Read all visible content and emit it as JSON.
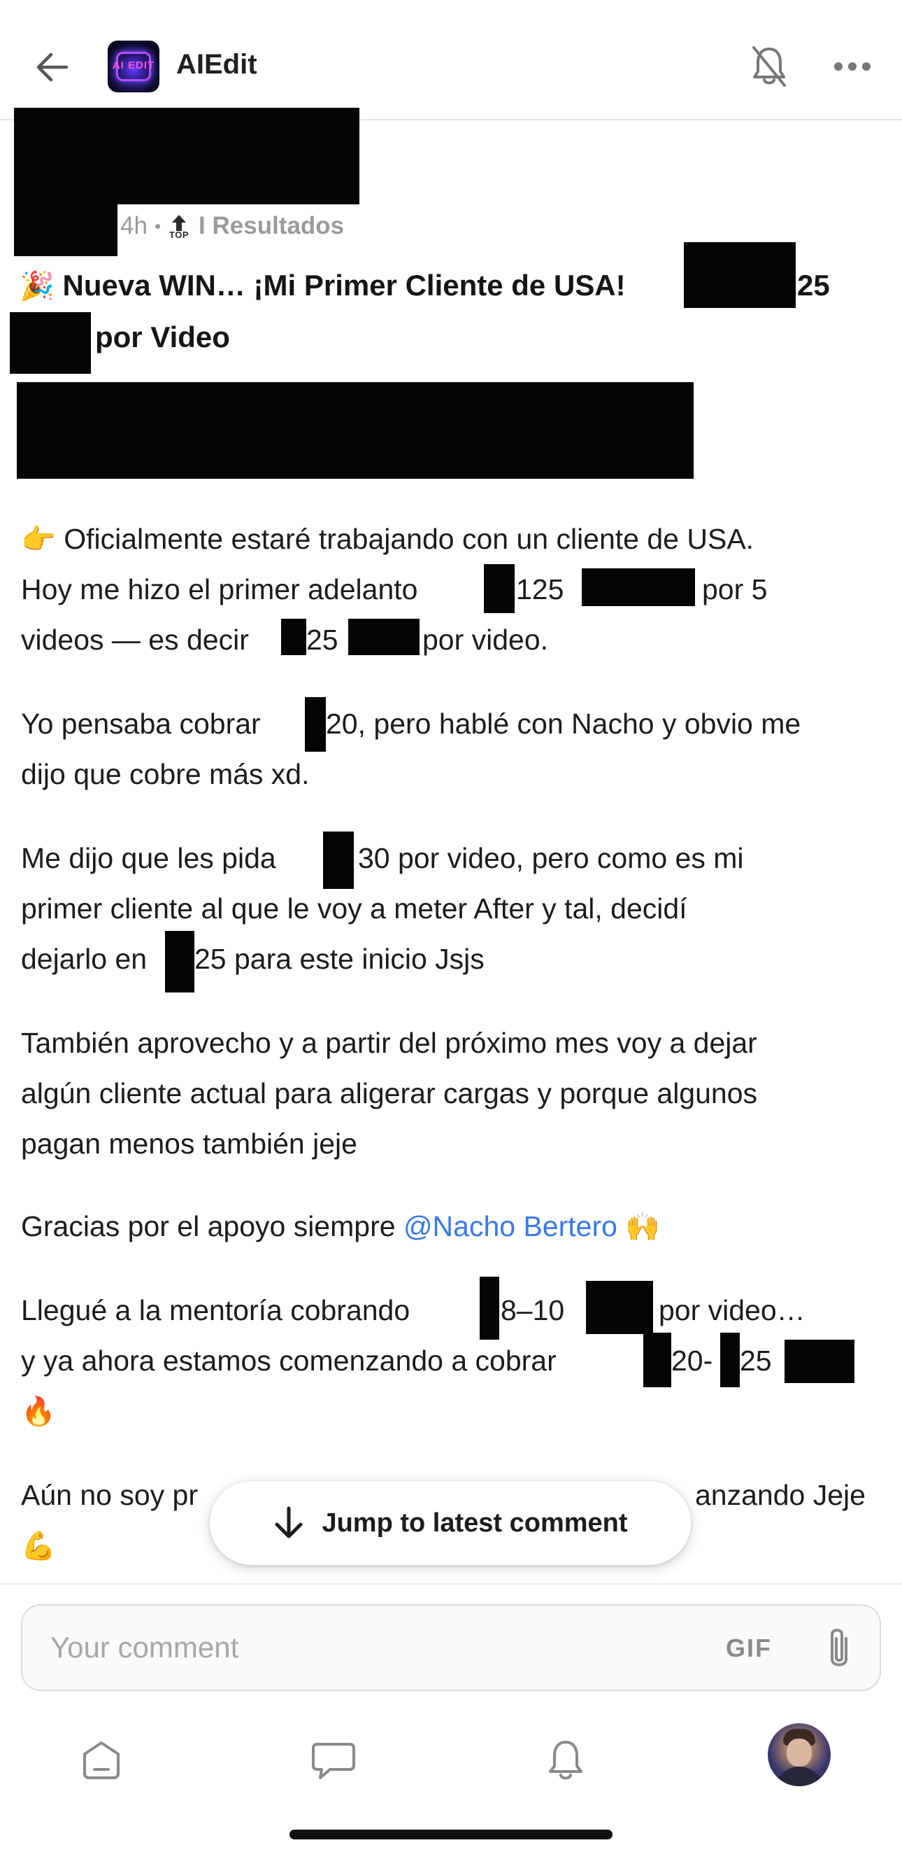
{
  "header": {
    "group_name": "AIEdit",
    "logo_text": "AI EDIT",
    "icons": [
      "back-arrow-icon",
      "bell-off-icon",
      "more-icon"
    ]
  },
  "post": {
    "time": "4h",
    "bullet": "•",
    "top_badge": "TOP",
    "category": "I Resultados",
    "title_line1_prefix": "Nueva WIN… ¡Mi Primer Cliente de USA!",
    "title_line1_suffix": "25",
    "title_line2": "por Video",
    "title_emoji": "🎉",
    "body": {
      "p1_emoji": "👉",
      "p1_l1": "Oficialmente estaré trabajando con un cliente de USA.",
      "p1_l2_a": "Hoy me hizo el primer adelanto",
      "p1_l2_b": "125",
      "p1_l2_c": "por 5",
      "p1_l3_a": "videos — es decir",
      "p1_l3_b": "25",
      "p1_l3_c": "por video.",
      "p2_l1_a": "Yo pensaba cobrar",
      "p2_l1_b": "20, pero hablé con Nacho y obvio me",
      "p2_l2": "dijo que cobre más xd.",
      "p3_l1_a": "Me dijo que les pida",
      "p3_l1_b": "30 por video, pero como es mi",
      "p3_l2": "primer cliente al que le voy a meter After y tal, decidí",
      "p3_l3_a": "dejarlo en",
      "p3_l3_b": "25 para este inicio Jsjs",
      "p4_l1": "También aprovecho y a partir del próximo mes voy a dejar",
      "p4_l2": "algún cliente actual para aligerar cargas y porque algunos",
      "p4_l3": "pagan menos también jeje",
      "p5_a": "Gracias por el apoyo siempre",
      "p5_mention": "@Nacho Bertero",
      "p5_emoji": "🙌",
      "p6_l1_a": "Llegué a la mentoría cobrando",
      "p6_l1_b": "8–10",
      "p6_l1_c": "por video…",
      "p6_l2_a": "y ya ahora estamos comenzando a cobrar",
      "p6_l2_b": "20-",
      "p6_l2_c": "25",
      "p6_emoji": "🔥",
      "p7_a": "Aún no soy pr",
      "p7_b": "anzando Jeje",
      "p7_emoji": "💪"
    }
  },
  "jump_button": {
    "label": "Jump to latest comment"
  },
  "comment_bar": {
    "placeholder": "Your comment",
    "gif_label": "GIF"
  },
  "bottom_nav": {
    "items": [
      "home-icon",
      "chat-icon",
      "notifications-icon",
      "profile-avatar"
    ]
  }
}
